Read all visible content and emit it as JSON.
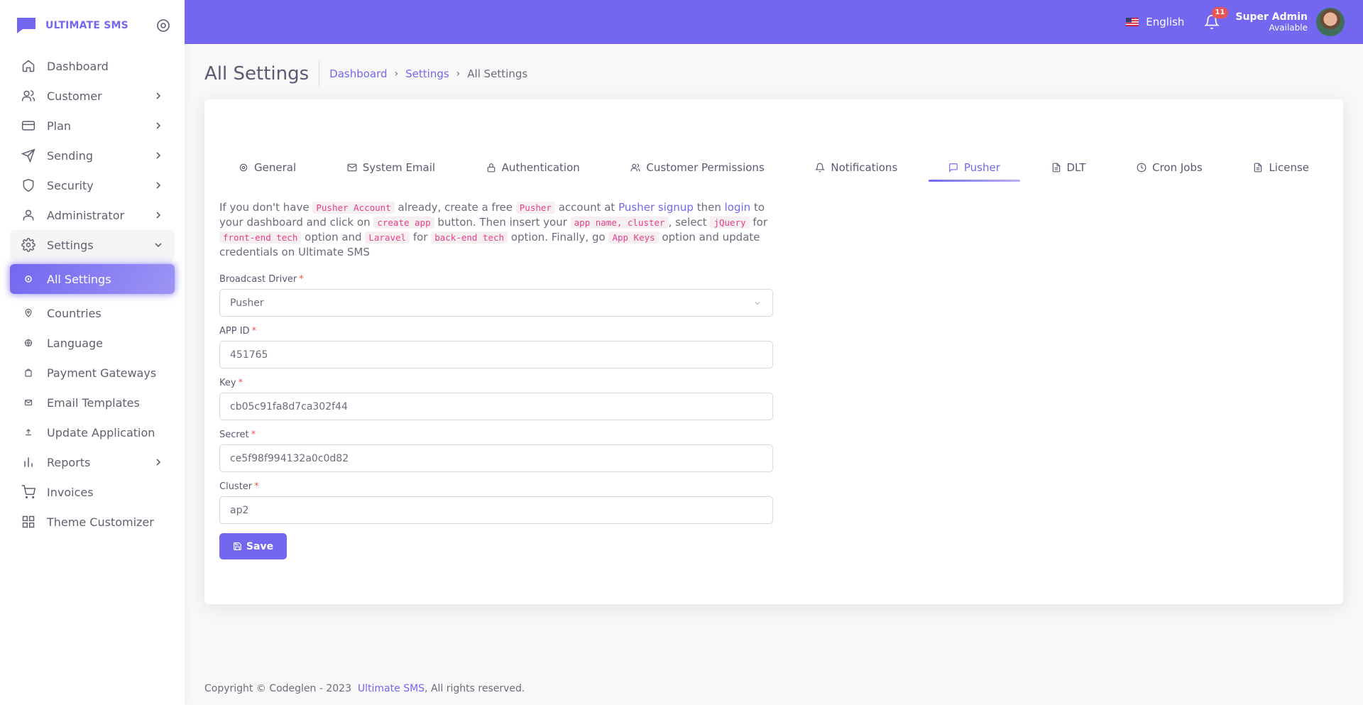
{
  "brand": {
    "name": "ULTIMATE SMS",
    "color": "#7367f0"
  },
  "sidebar": {
    "items": [
      {
        "label": "Dashboard",
        "icon": "home-icon"
      },
      {
        "label": "Customer",
        "icon": "users-icon"
      },
      {
        "label": "Plan",
        "icon": "credit-card-icon"
      },
      {
        "label": "Sending",
        "icon": "send-icon"
      },
      {
        "label": "Security",
        "icon": "shield-icon"
      },
      {
        "label": "Administrator",
        "icon": "user-icon"
      },
      {
        "label": "Settings",
        "icon": "settings-icon"
      }
    ],
    "settings_sub": [
      {
        "label": "All Settings"
      },
      {
        "label": "Countries"
      },
      {
        "label": "Language"
      },
      {
        "label": "Payment Gateways"
      },
      {
        "label": "Email Templates"
      },
      {
        "label": "Update Application"
      }
    ],
    "bottom": [
      {
        "label": "Reports",
        "icon": "bar-chart-icon"
      },
      {
        "label": "Invoices",
        "icon": "shopping-cart-icon"
      },
      {
        "label": "Theme Customizer",
        "icon": "grid-icon"
      }
    ]
  },
  "header": {
    "language": "English",
    "notifications_count": "11",
    "user_name": "Super Admin",
    "user_status": "Available"
  },
  "page": {
    "title": "All Settings",
    "breadcrumb": [
      "Dashboard",
      "Settings",
      "All Settings"
    ]
  },
  "tabs": [
    {
      "label": "General",
      "icon": "gear-icon"
    },
    {
      "label": "System Email",
      "icon": "mail-icon"
    },
    {
      "label": "Authentication",
      "icon": "lock-icon"
    },
    {
      "label": "Customer Permissions",
      "icon": "users-icon"
    },
    {
      "label": "Notifications",
      "icon": "bell-icon"
    },
    {
      "label": "Pusher",
      "icon": "message-square-icon"
    },
    {
      "label": "DLT",
      "icon": "file-text-icon"
    },
    {
      "label": "Cron Jobs",
      "icon": "clock-icon"
    },
    {
      "label": "License",
      "icon": "file-icon"
    }
  ],
  "intro": {
    "t1": "If you don't have",
    "c1": "Pusher Account",
    "t2": "already, create a free",
    "c2": "Pusher",
    "t3": "account at",
    "l1": "Pusher signup",
    "t4": "then",
    "l2": "login",
    "t5": "to your dashboard and click on",
    "c3": "create app",
    "t6": "button. Then insert your",
    "c4": "app name, cluster",
    "t7": ", select",
    "c5": "jQuery",
    "t8": "for",
    "c6": "front-end tech",
    "t9": "option and",
    "c7": "Laravel",
    "t10": "for",
    "c8": "back-end tech",
    "t11": "option. Finally, go",
    "c9": "App Keys",
    "t12": "option and update credentials on Ultimate SMS"
  },
  "form": {
    "driver_label": "Broadcast Driver",
    "driver_value": "Pusher",
    "app_id_label": "APP ID",
    "app_id_value": "451765",
    "key_label": "Key",
    "key_value": "cb05c91fa8d7ca302f44",
    "secret_label": "Secret",
    "secret_value": "ce5f98f994132a0c0d82",
    "cluster_label": "Cluster",
    "cluster_value": "ap2",
    "required_mark": "*",
    "save_label": "Save"
  },
  "footer": {
    "prefix": "Copyright © Codeglen - 2023",
    "link": "Ultimate SMS",
    "suffix": ", All rights reserved."
  }
}
